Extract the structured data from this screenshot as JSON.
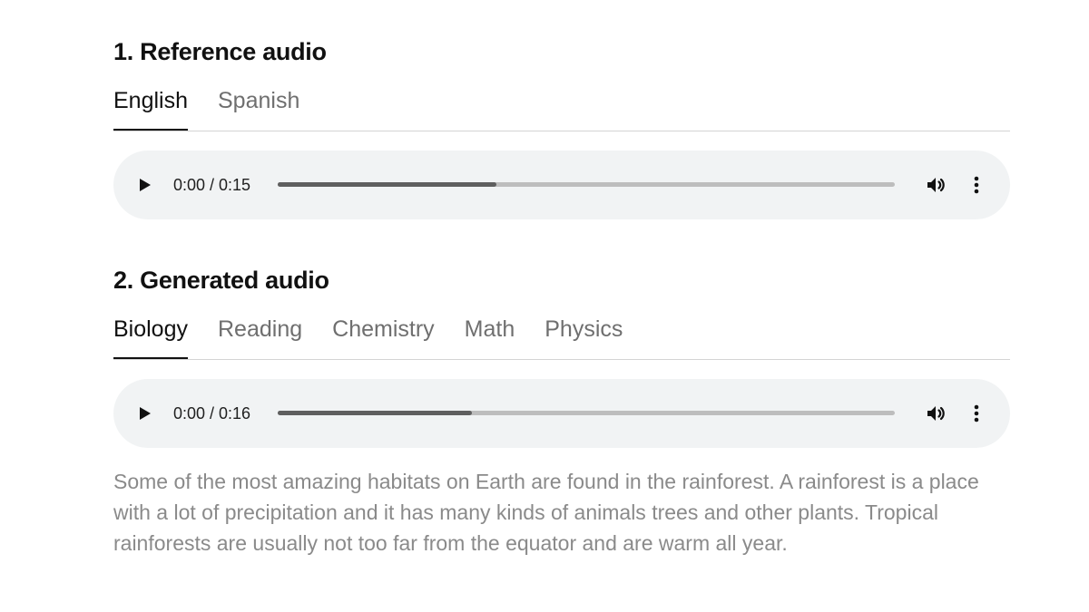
{
  "reference": {
    "title": "1. Reference audio",
    "tabs": [
      {
        "label": "English",
        "active": true
      },
      {
        "label": "Spanish",
        "active": false
      }
    ],
    "player": {
      "time": "0:00 / 0:15",
      "progress_fraction": 0.355
    }
  },
  "generated": {
    "title": "2. Generated audio",
    "tabs": [
      {
        "label": "Biology",
        "active": true
      },
      {
        "label": "Reading",
        "active": false
      },
      {
        "label": "Chemistry",
        "active": false
      },
      {
        "label": "Math",
        "active": false
      },
      {
        "label": "Physics",
        "active": false
      }
    ],
    "player": {
      "time": "0:00 / 0:16",
      "progress_fraction": 0.315
    },
    "transcript": "Some of the most amazing habitats on Earth are found in the rainforest. A rainforest is a place with a lot of precipitation and it has many kinds of animals trees and other plants. Tropical rainforests are usually not too far from the equator and are warm all year."
  },
  "icons": {
    "play": "play-icon",
    "volume": "volume-icon",
    "more": "more-vert-icon"
  }
}
